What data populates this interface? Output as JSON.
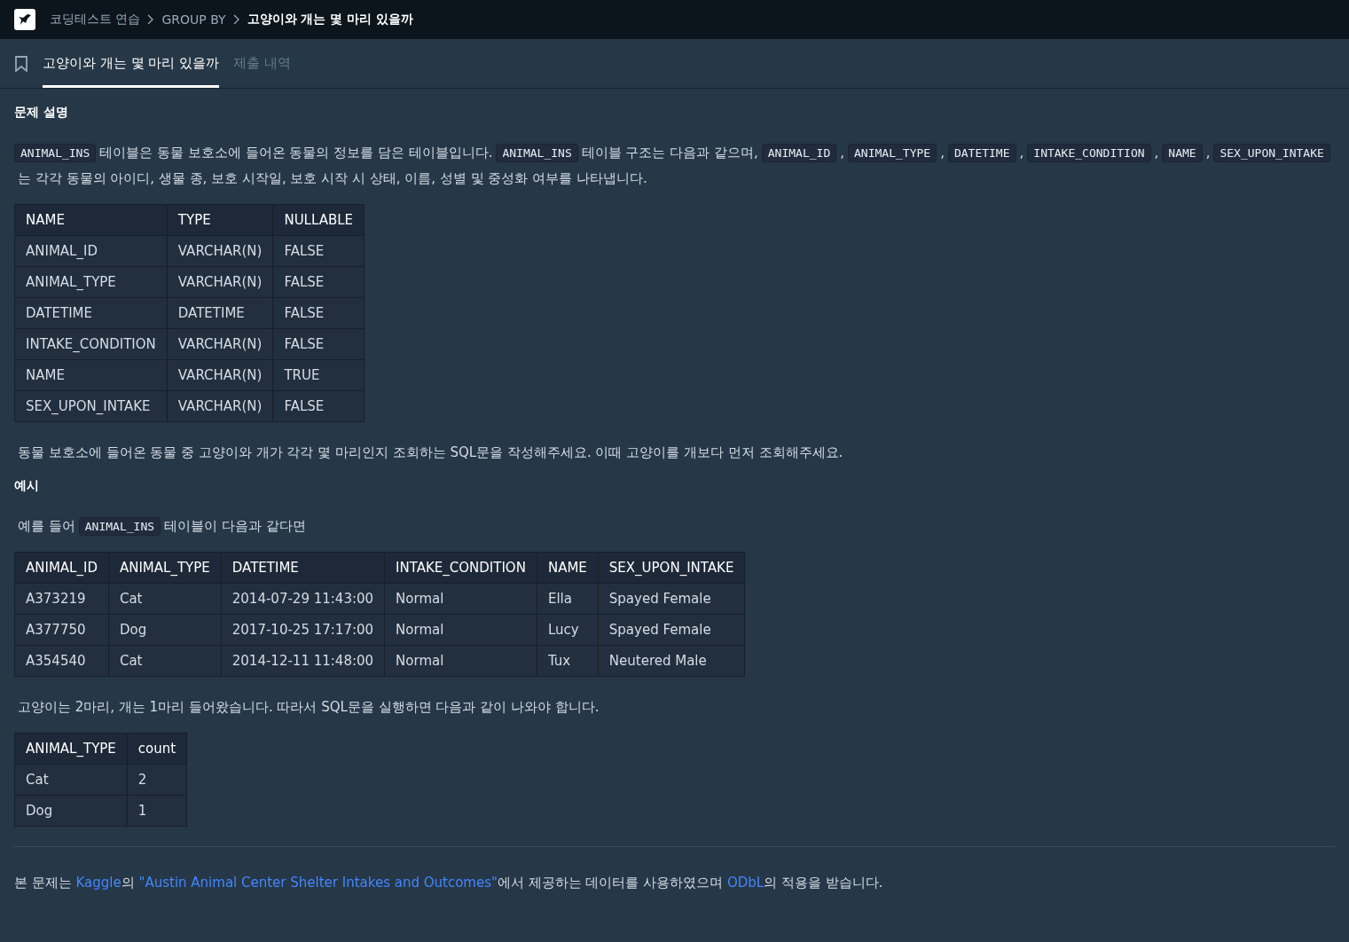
{
  "breadcrumb": [
    {
      "label": "코딩테스트 연습",
      "current": false
    },
    {
      "label": "GROUP BY",
      "current": false
    },
    {
      "label": "고양이와 개는 몇 마리 있을까",
      "current": true
    }
  ],
  "tabs": [
    {
      "label": "고양이와 개는 몇 마리 있을까",
      "selected": true
    },
    {
      "label": "제출 내역",
      "selected": false
    }
  ],
  "sections": [
    {
      "kind": "heading",
      "text": "문제 설명"
    },
    {
      "kind": "paragraph",
      "segments": [
        {
          "kind": "code",
          "text": "ANIMAL_INS"
        },
        {
          "kind": "text",
          "text": "테이블은 동물 보호소에 들어온 동물의 정보를 담은 테이블입니다."
        },
        {
          "kind": "code",
          "text": "ANIMAL_INS"
        },
        {
          "kind": "text",
          "text": "테이블 구조는 다음과 같으며,"
        },
        {
          "kind": "code",
          "text": "ANIMAL_ID"
        },
        {
          "kind": "text",
          "text": ","
        },
        {
          "kind": "code",
          "text": "ANIMAL_TYPE"
        },
        {
          "kind": "text",
          "text": ","
        },
        {
          "kind": "code",
          "text": "DATETIME"
        },
        {
          "kind": "text",
          "text": ","
        },
        {
          "kind": "code",
          "text": "INTAKE_CONDITION"
        },
        {
          "kind": "text",
          "text": ","
        },
        {
          "kind": "code",
          "text": "NAME"
        },
        {
          "kind": "text",
          "text": ","
        },
        {
          "kind": "code",
          "text": "SEX_UPON_INTAKE"
        },
        {
          "kind": "text",
          "text": "는 각각 동물의 아이디, 생물 종, 보호 시작일, 보호 시작 시 상태, 이름, 성별 및 중성화 여부를 나타냅니다."
        }
      ]
    },
    {
      "kind": "table",
      "columns": [
        "NAME",
        "TYPE",
        "NULLABLE"
      ],
      "rows": [
        [
          "ANIMAL_ID",
          "VARCHAR(N)",
          "FALSE"
        ],
        [
          "ANIMAL_TYPE",
          "VARCHAR(N)",
          "FALSE"
        ],
        [
          "DATETIME",
          "DATETIME",
          "FALSE"
        ],
        [
          "INTAKE_CONDITION",
          "VARCHAR(N)",
          "FALSE"
        ],
        [
          "NAME",
          "VARCHAR(N)",
          "TRUE"
        ],
        [
          "SEX_UPON_INTAKE",
          "VARCHAR(N)",
          "FALSE"
        ]
      ]
    },
    {
      "kind": "paragraph",
      "segments": [
        {
          "kind": "text",
          "text": "동물 보호소에 들어온 동물 중 고양이와 개가 각각 몇 마리인지 조회하는 SQL문을 작성해주세요. 이때 고양이를 개보다 먼저 조회해주세요."
        }
      ]
    },
    {
      "kind": "heading",
      "text": "예시"
    },
    {
      "kind": "paragraph",
      "segments": [
        {
          "kind": "text",
          "text": "예를 들어"
        },
        {
          "kind": "code",
          "text": "ANIMAL_INS"
        },
        {
          "kind": "text",
          "text": "테이블이 다음과 같다면"
        }
      ]
    },
    {
      "kind": "table",
      "columns": [
        "ANIMAL_ID",
        "ANIMAL_TYPE",
        "DATETIME",
        "INTAKE_CONDITION",
        "NAME",
        "SEX_UPON_INTAKE"
      ],
      "rows": [
        [
          "A373219",
          "Cat",
          "2014-07-29 11:43:00",
          "Normal",
          "Ella",
          "Spayed Female"
        ],
        [
          "A377750",
          "Dog",
          "2017-10-25 17:17:00",
          "Normal",
          "Lucy",
          "Spayed Female"
        ],
        [
          "A354540",
          "Cat",
          "2014-12-11 11:48:00",
          "Normal",
          "Tux",
          "Neutered Male"
        ]
      ]
    },
    {
      "kind": "paragraph",
      "segments": [
        {
          "kind": "text",
          "text": "고양이는 2마리, 개는 1마리 들어왔습니다. 따라서 SQL문을 실행하면 다음과 같이 나와야 합니다."
        }
      ]
    },
    {
      "kind": "table",
      "columns": [
        "ANIMAL_TYPE",
        "count"
      ],
      "rows": [
        [
          "Cat",
          "2"
        ],
        [
          "Dog",
          "1"
        ]
      ]
    },
    {
      "kind": "rule"
    },
    {
      "kind": "footnote",
      "segments": [
        {
          "kind": "text",
          "text": "본 문제는 "
        },
        {
          "kind": "link",
          "text": "Kaggle"
        },
        {
          "kind": "text",
          "text": "의 "
        },
        {
          "kind": "link",
          "text": "\"Austin Animal Center Shelter Intakes and Outcomes\""
        },
        {
          "kind": "text",
          "text": "에서 제공하는 데이터를 사용하였으며 "
        },
        {
          "kind": "link",
          "text": "ODbL"
        },
        {
          "kind": "text",
          "text": "의 적용을 받습니다."
        }
      ]
    }
  ]
}
